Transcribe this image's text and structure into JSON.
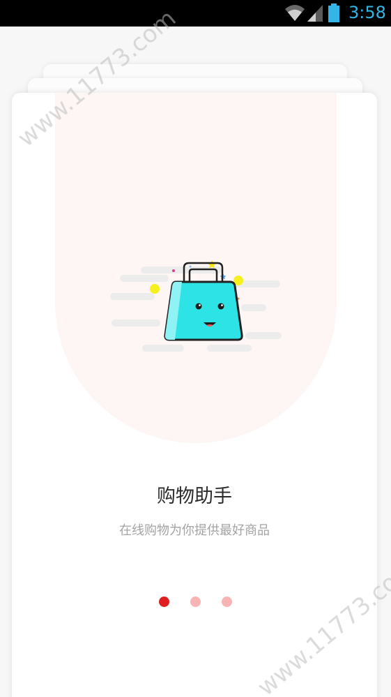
{
  "status_bar": {
    "time": "3:58",
    "icons": [
      "wifi-icon",
      "signal-icon",
      "battery-icon"
    ],
    "clock_color": "#33b5e5"
  },
  "onboarding": {
    "title": "购物助手",
    "subtitle": "在线购物为你提供最好商品",
    "illustration": "shopping-bag-icon",
    "page_indicator": {
      "current": 1,
      "total": 3
    }
  },
  "watermark": "www.11773.com",
  "colors": {
    "accent": "#e02020",
    "dot_inactive": "#f7b4b4",
    "bag": "#2ee3e6",
    "arch": "#fdf6f5"
  }
}
